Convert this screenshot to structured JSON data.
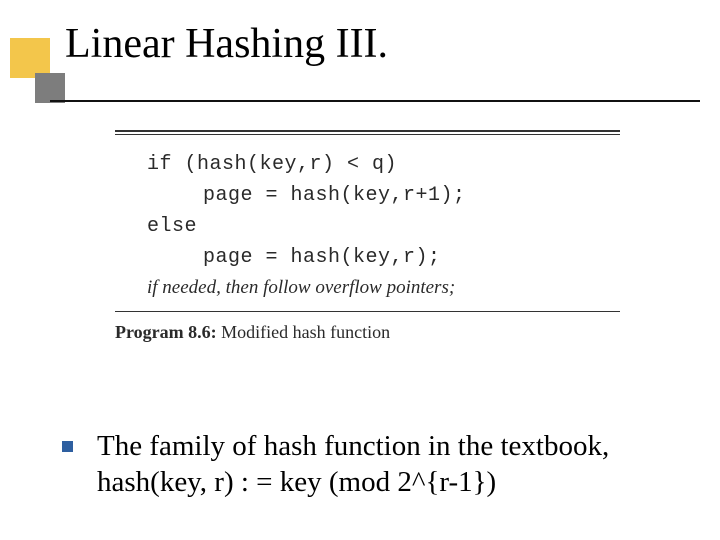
{
  "title": "Linear Hashing III.",
  "code": {
    "l1": "if (hash(key,r) < q)",
    "l2": "page = hash(key,r+1);",
    "l3": "else",
    "l4": "page = hash(key,r);",
    "note": "if needed, then follow overflow pointers;"
  },
  "program_label_prefix": "Program 8.6:",
  "program_label_rest": " Modified hash function",
  "bullet": {
    "text": "The family of hash function in the textbook, hash(key, r) : = key (mod 2^{r-1})"
  },
  "colors": {
    "accent_yellow": "#f3c64b",
    "accent_gray": "#7d7d7d",
    "bullet_blue": "#2e5fa0"
  }
}
